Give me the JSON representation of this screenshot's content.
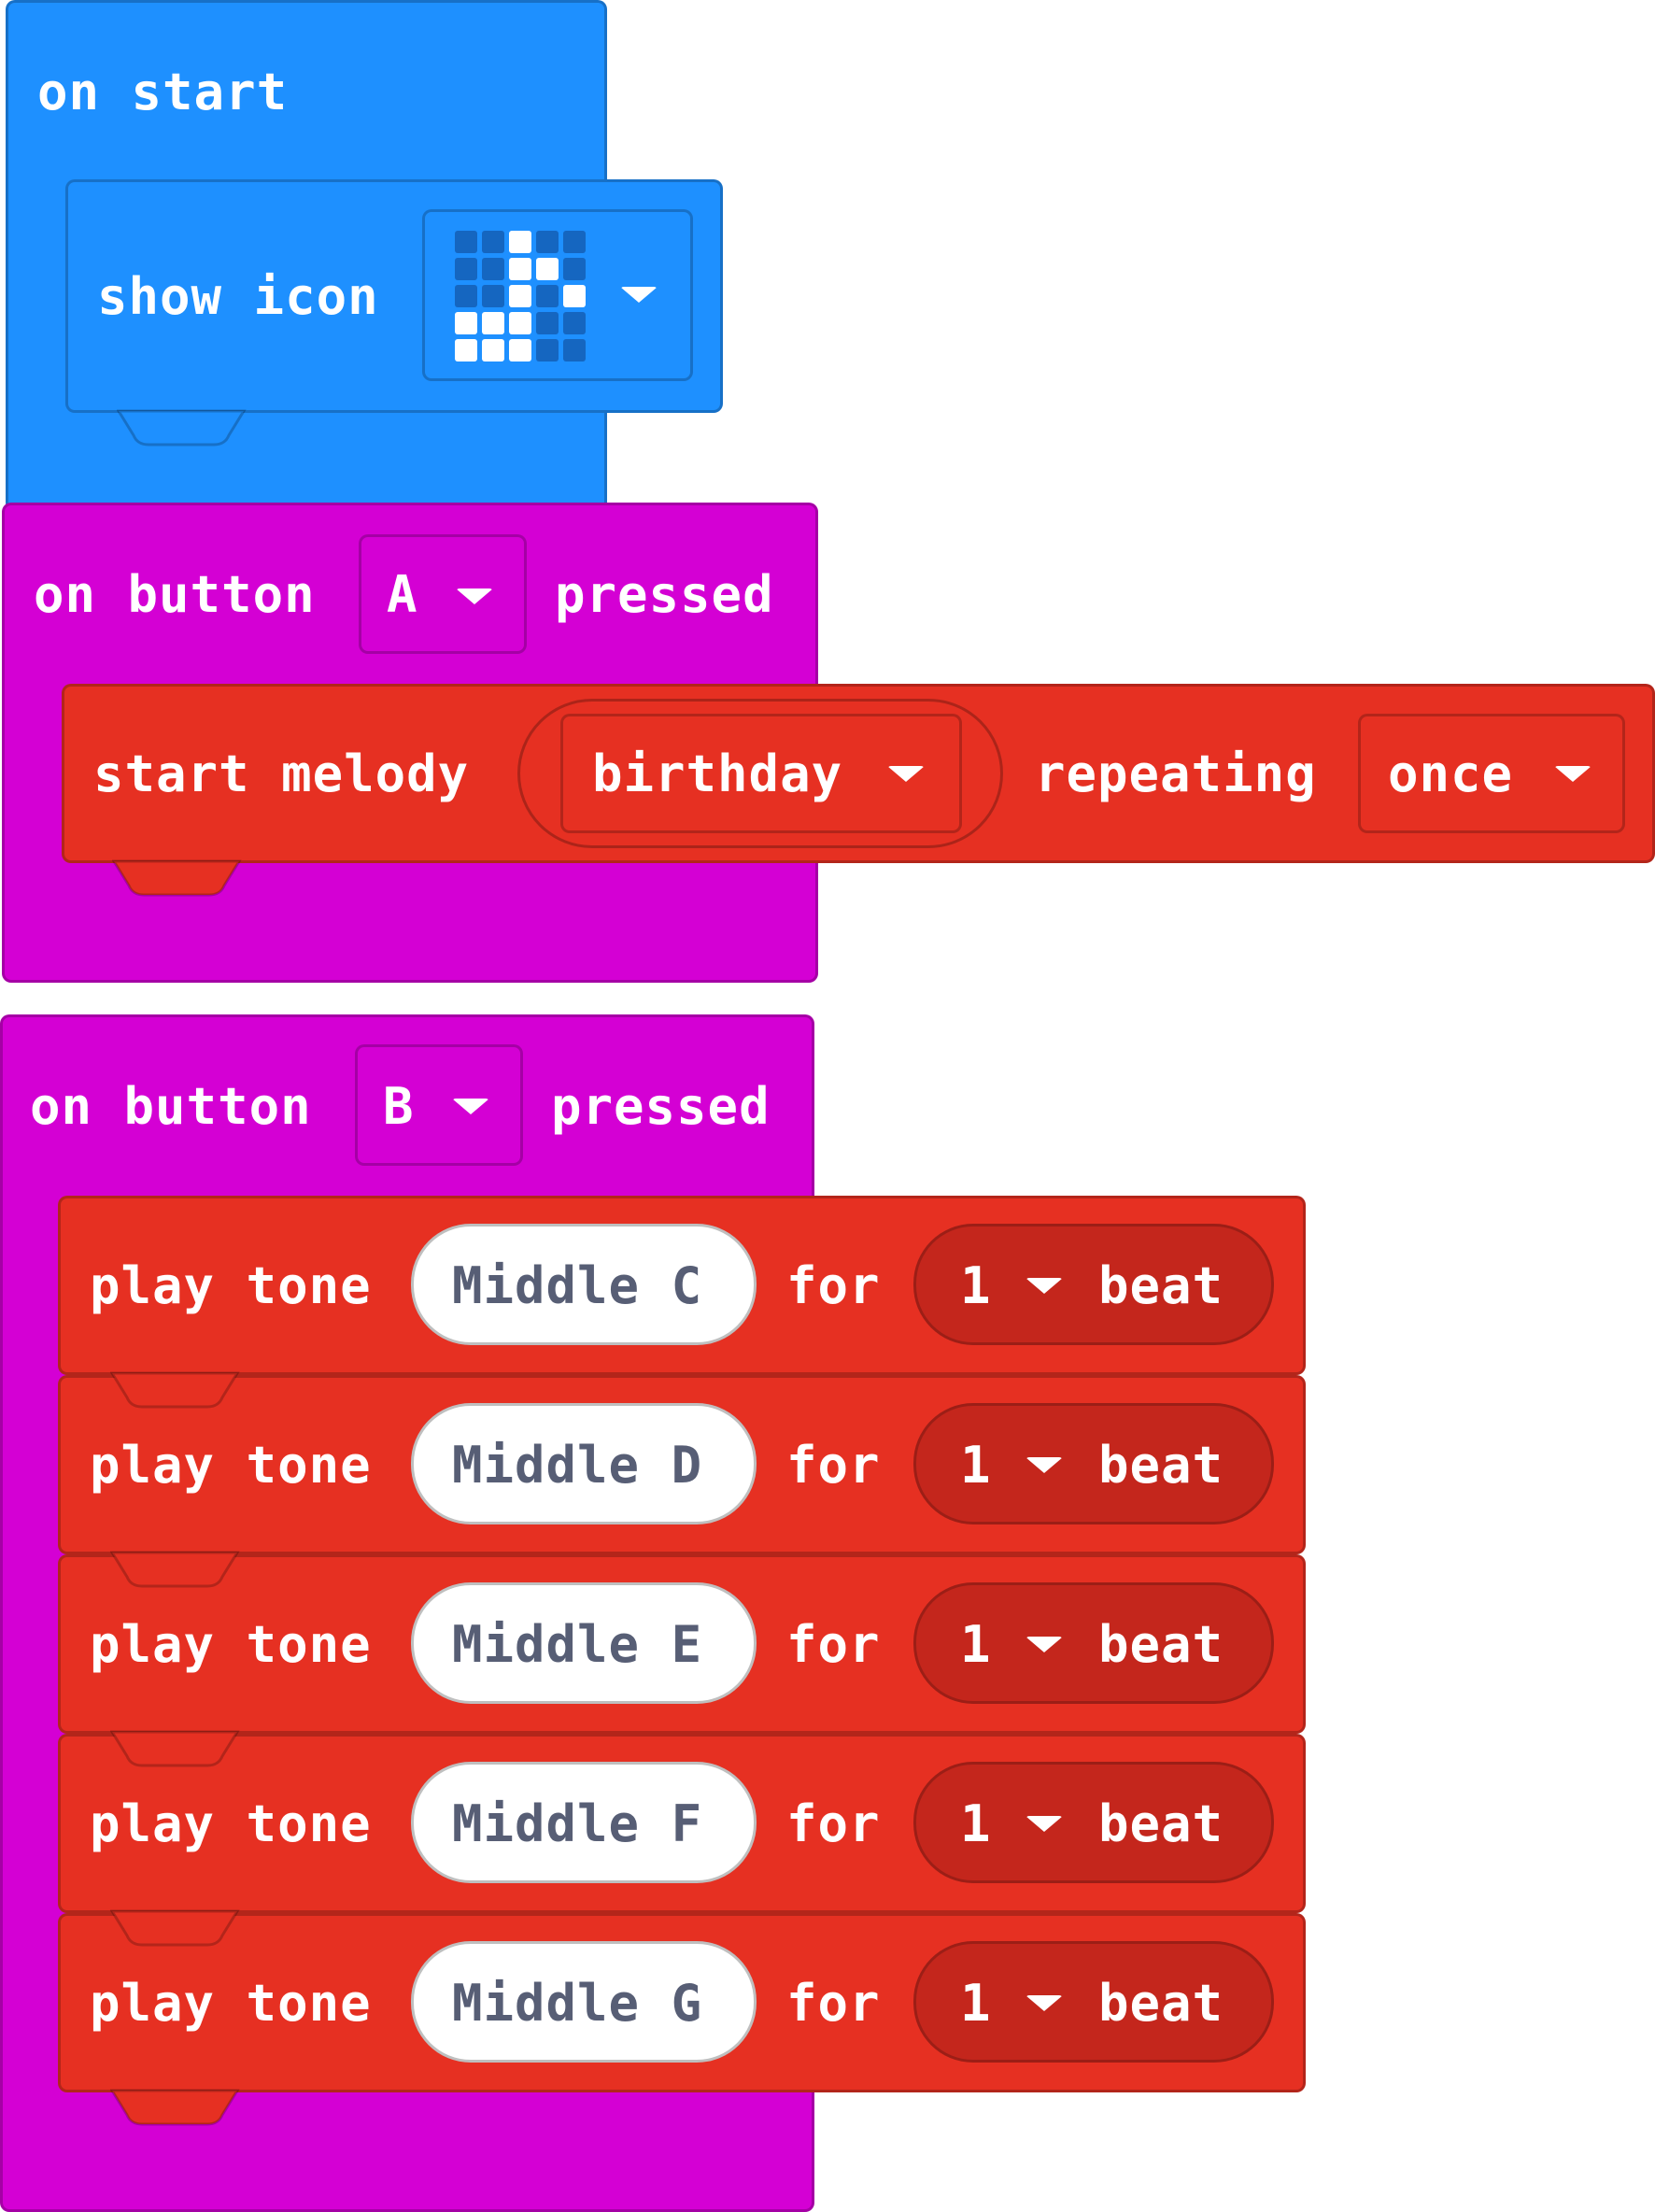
{
  "blocks": {
    "on_start": {
      "label": "on start",
      "show_icon": {
        "label": "show icon",
        "icon_grid": [
          [
            0,
            0,
            1,
            0,
            0
          ],
          [
            0,
            0,
            1,
            1,
            0
          ],
          [
            0,
            0,
            1,
            0,
            1
          ],
          [
            1,
            1,
            1,
            0,
            0
          ],
          [
            1,
            1,
            1,
            0,
            0
          ]
        ]
      }
    },
    "button_a": {
      "prefix": "on button",
      "button": "A",
      "suffix": "pressed",
      "start_melody": {
        "label": "start melody",
        "melody": "birthday",
        "repeating_label": "repeating",
        "repeat": "once"
      }
    },
    "button_b": {
      "prefix": "on button",
      "button": "B",
      "suffix": "pressed",
      "tones": [
        {
          "label": "play tone",
          "note": "Middle C",
          "for_label": "for",
          "beats": "1",
          "beat_label": "beat"
        },
        {
          "label": "play tone",
          "note": "Middle D",
          "for_label": "for",
          "beats": "1",
          "beat_label": "beat"
        },
        {
          "label": "play tone",
          "note": "Middle E",
          "for_label": "for",
          "beats": "1",
          "beat_label": "beat"
        },
        {
          "label": "play tone",
          "note": "Middle F",
          "for_label": "for",
          "beats": "1",
          "beat_label": "beat"
        },
        {
          "label": "play tone",
          "note": "Middle G",
          "for_label": "for",
          "beats": "1",
          "beat_label": "beat"
        }
      ]
    }
  },
  "colors": {
    "basic": "#1e90ff",
    "input": "#d400d4",
    "music": "#e63022",
    "music_dark": "#c4261c"
  }
}
